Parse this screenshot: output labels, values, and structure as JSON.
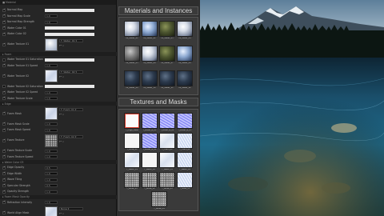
{
  "details": {
    "header": "■ Material",
    "params": [
      {
        "label": "Normal Map",
        "checked": true
      },
      {
        "label": "Normal Map Scale",
        "checked": true,
        "value": "1.0"
      },
      {
        "label": "Normal Map Strength",
        "checked": true,
        "value": "1.0"
      },
      {
        "label": "Water Color 01",
        "checked": true
      },
      {
        "label": "Water Color 02",
        "checked": true
      },
      {
        "label": "Water Texture 01",
        "checked": true,
        "dropdown": "T_Water_01"
      },
      {
        "label": "Water Texture 01 Saturation",
        "checked": false
      },
      {
        "label": "Water Texture 01 Speed",
        "checked": true,
        "value": "1.0"
      },
      {
        "label": "Water Texture 02",
        "checked": true,
        "dropdown": "T_Water_02"
      },
      {
        "label": "Water Texture 02 Saturation",
        "checked": false
      },
      {
        "label": "Water Texture 02 Speed",
        "checked": true,
        "value": "1.0"
      },
      {
        "label": "Water Texture Scale",
        "checked": true,
        "value": "1.0"
      },
      {
        "label": "Foam Mask",
        "checked": true,
        "dropdown": "T_Foam_01"
      },
      {
        "label": "Foam Mask Scale",
        "checked": true,
        "value": "1.0"
      },
      {
        "label": "Foam Mask Speed",
        "checked": true,
        "value": "1.0"
      },
      {
        "label": "Foam Texture",
        "checked": true,
        "dropdown": "T_Foam_02"
      },
      {
        "label": "Foam Texture Scale",
        "checked": true,
        "value": "1.0"
      },
      {
        "label": "Foam Texture Speed",
        "checked": true,
        "value": "1.0"
      },
      {
        "label": "Edge Opacity",
        "checked": true,
        "value": "0.5"
      },
      {
        "label": "Edge Width",
        "checked": true,
        "value": "1.0"
      },
      {
        "label": "Wave Tiling",
        "checked": true,
        "value": "1.0"
      },
      {
        "label": "Specular Strength",
        "checked": true,
        "value": "0.5"
      },
      {
        "label": "Opacity Strength",
        "checked": true,
        "value": "1.0"
      },
      {
        "label": "Refraction Intensity",
        "checked": true,
        "value": "1.0"
      },
      {
        "label": "World Align Mask",
        "checked": true,
        "dropdown": "None"
      }
    ],
    "sections": [
      "Foam",
      "Edge",
      "Water Color 03",
      "Foam Mask Opacity"
    ]
  },
  "materials": {
    "title": "Materials and Instances",
    "items": [
      {
        "caption": "MI_Water_01",
        "style": "sphere-snow"
      },
      {
        "caption": "MI_Water_02",
        "style": "sphere-ice"
      },
      {
        "caption": "MI_Water_03",
        "style": "sphere-moss"
      },
      {
        "caption": "MI_Water_04",
        "style": "sphere-snow"
      },
      {
        "caption": "MI_Water_05",
        "style": "sphere-grey"
      },
      {
        "caption": "MI_Water_06",
        "style": "sphere-snow"
      },
      {
        "caption": "MI_Water_07",
        "style": "sphere-moss"
      },
      {
        "caption": "MI_Water_08",
        "style": "sphere-ice"
      },
      {
        "caption": "MI_Water_09",
        "style": "sphere-dark"
      },
      {
        "caption": "MI_Water_10",
        "style": "sphere-dark"
      },
      {
        "caption": "MI_Water_11",
        "style": "sphere-dark"
      },
      {
        "caption": "MI_Water_12",
        "style": "sphere-dark"
      }
    ]
  },
  "textures": {
    "title": "Textures and Masks",
    "items": [
      {
        "caption": "T_Edge_Mask",
        "style": "tx-red"
      },
      {
        "caption": "T_Water_N_01",
        "style": "tx-normal"
      },
      {
        "caption": "T_Water_N_02",
        "style": "tx-normal"
      },
      {
        "caption": "T_Water_N_03",
        "style": "tx-normal"
      },
      {
        "caption": "T_Snow_01",
        "style": "tx-white"
      },
      {
        "caption": "T_Water_N_04",
        "style": "tx-normal"
      },
      {
        "caption": "T_Foam_01",
        "style": "tx-snow"
      },
      {
        "caption": "T_Foam_02",
        "style": "tx-bluepat"
      },
      {
        "caption": "T_Water_01",
        "style": "tx-snow"
      },
      {
        "caption": "T_Water_02",
        "style": "tx-white"
      },
      {
        "caption": "T_Water_03",
        "style": "tx-snow"
      },
      {
        "caption": "T_Water_04",
        "style": "tx-bluepat"
      },
      {
        "caption": "T_Noise_01",
        "style": "tx-noise"
      },
      {
        "caption": "T_Noise_02",
        "style": "tx-noise"
      },
      {
        "caption": "T_Noise_03",
        "style": "tx-noise"
      },
      {
        "caption": "T_Mask_01",
        "style": "tx-bluepat"
      },
      {
        "caption": "T_Noise_04",
        "style": "tx-noise"
      }
    ]
  },
  "colors": {
    "panel_bg": "#262626",
    "grid_panel": "#3a3a3a",
    "title_text": "#dcdcdc",
    "lake_blue": "#1f6a8a"
  }
}
